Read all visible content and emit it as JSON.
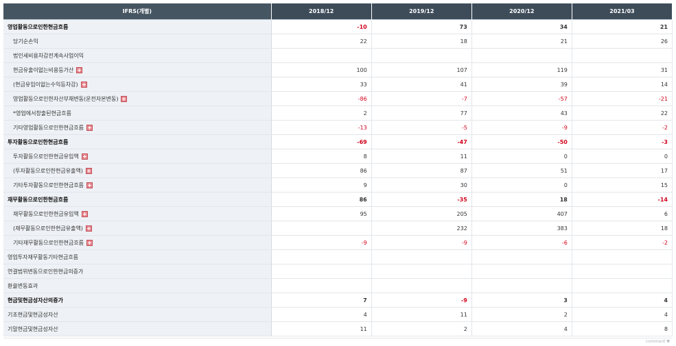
{
  "table": {
    "header": [
      "IFRS(개별)",
      "2018/12",
      "2019/12",
      "2020/12",
      "2021/03"
    ],
    "rows": [
      {
        "label": "영업활동으로인한현금흐름",
        "bold": true,
        "indent": false,
        "expand": false,
        "values": [
          "-10",
          "73",
          "34",
          "21"
        ]
      },
      {
        "label": "당기순손익",
        "bold": false,
        "indent": true,
        "expand": false,
        "values": [
          "22",
          "18",
          "21",
          "26"
        ]
      },
      {
        "label": "법인세비용차감전계속사업이익",
        "bold": false,
        "indent": true,
        "expand": false,
        "values": [
          "",
          "",
          "",
          ""
        ]
      },
      {
        "label": "현금유출이없는비용등가산",
        "bold": false,
        "indent": true,
        "expand": true,
        "values": [
          "100",
          "107",
          "119",
          "31"
        ]
      },
      {
        "label": "(현금유입이없는수익등차감)",
        "bold": false,
        "indent": true,
        "expand": true,
        "values": [
          "33",
          "41",
          "39",
          "14"
        ]
      },
      {
        "label": "영업활동으로인한자산부채변동(운전자본변동)",
        "bold": false,
        "indent": true,
        "expand": true,
        "values": [
          "-86",
          "-7",
          "-57",
          "-21"
        ]
      },
      {
        "label": "*영업에서창출된현금흐름",
        "bold": false,
        "indent": true,
        "expand": false,
        "values": [
          "2",
          "77",
          "43",
          "22"
        ]
      },
      {
        "label": "기타영업활동으로인한현금흐름",
        "bold": false,
        "indent": true,
        "expand": true,
        "values": [
          "-13",
          "-5",
          "-9",
          "-2"
        ]
      },
      {
        "label": "투자활동으로인한현금흐름",
        "bold": true,
        "indent": false,
        "expand": false,
        "values": [
          "-69",
          "-47",
          "-50",
          "-3"
        ]
      },
      {
        "label": "투자활동으로인한현금유입액",
        "bold": false,
        "indent": true,
        "expand": true,
        "values": [
          "8",
          "11",
          "0",
          "0"
        ]
      },
      {
        "label": "(투자활동으로인한현금유출액)",
        "bold": false,
        "indent": true,
        "expand": true,
        "values": [
          "86",
          "87",
          "51",
          "17"
        ]
      },
      {
        "label": "기타투자활동으로인한현금흐름",
        "bold": false,
        "indent": true,
        "expand": true,
        "values": [
          "9",
          "30",
          "0",
          "15"
        ]
      },
      {
        "label": "재무활동으로인한현금흐름",
        "bold": true,
        "indent": false,
        "expand": false,
        "values": [
          "86",
          "-35",
          "18",
          "-14"
        ]
      },
      {
        "label": "재무활동으로인한현금유입액",
        "bold": false,
        "indent": true,
        "expand": true,
        "values": [
          "95",
          "205",
          "407",
          "6"
        ]
      },
      {
        "label": "(재무활동으로인한현금유출액)",
        "bold": false,
        "indent": true,
        "expand": true,
        "values": [
          "",
          "232",
          "383",
          "18"
        ]
      },
      {
        "label": "기타재무활동으로인한현금흐름",
        "bold": false,
        "indent": true,
        "expand": true,
        "values": [
          "-9",
          "-9",
          "-6",
          "-2"
        ]
      },
      {
        "label": "영업투자재무활동기타현금흐름",
        "bold": false,
        "indent": false,
        "expand": false,
        "values": [
          "",
          "",
          "",
          ""
        ]
      },
      {
        "label": "연결범위변동으로인한현금의증가",
        "bold": false,
        "indent": false,
        "expand": false,
        "values": [
          "",
          "",
          "",
          ""
        ]
      },
      {
        "label": "환율변동효과",
        "bold": false,
        "indent": false,
        "expand": false,
        "values": [
          "",
          "",
          "",
          ""
        ]
      },
      {
        "label": "현금및현금성자산의증가",
        "bold": true,
        "indent": false,
        "expand": false,
        "values": [
          "7",
          "-9",
          "3",
          "4"
        ]
      },
      {
        "label": "기초현금및현금성자산",
        "bold": false,
        "indent": false,
        "expand": false,
        "values": [
          "4",
          "11",
          "2",
          "4"
        ]
      },
      {
        "label": "기말현금및현금성자산",
        "bold": false,
        "indent": false,
        "expand": false,
        "values": [
          "11",
          "2",
          "4",
          "8"
        ]
      }
    ]
  },
  "footer": {
    "text": "comment ▼"
  },
  "colors": {
    "header_bg": "#3e4c5a",
    "negative": "#d0021b",
    "label_bg": "#eef1f5"
  },
  "icons": {
    "expand": "plus-square-icon"
  }
}
